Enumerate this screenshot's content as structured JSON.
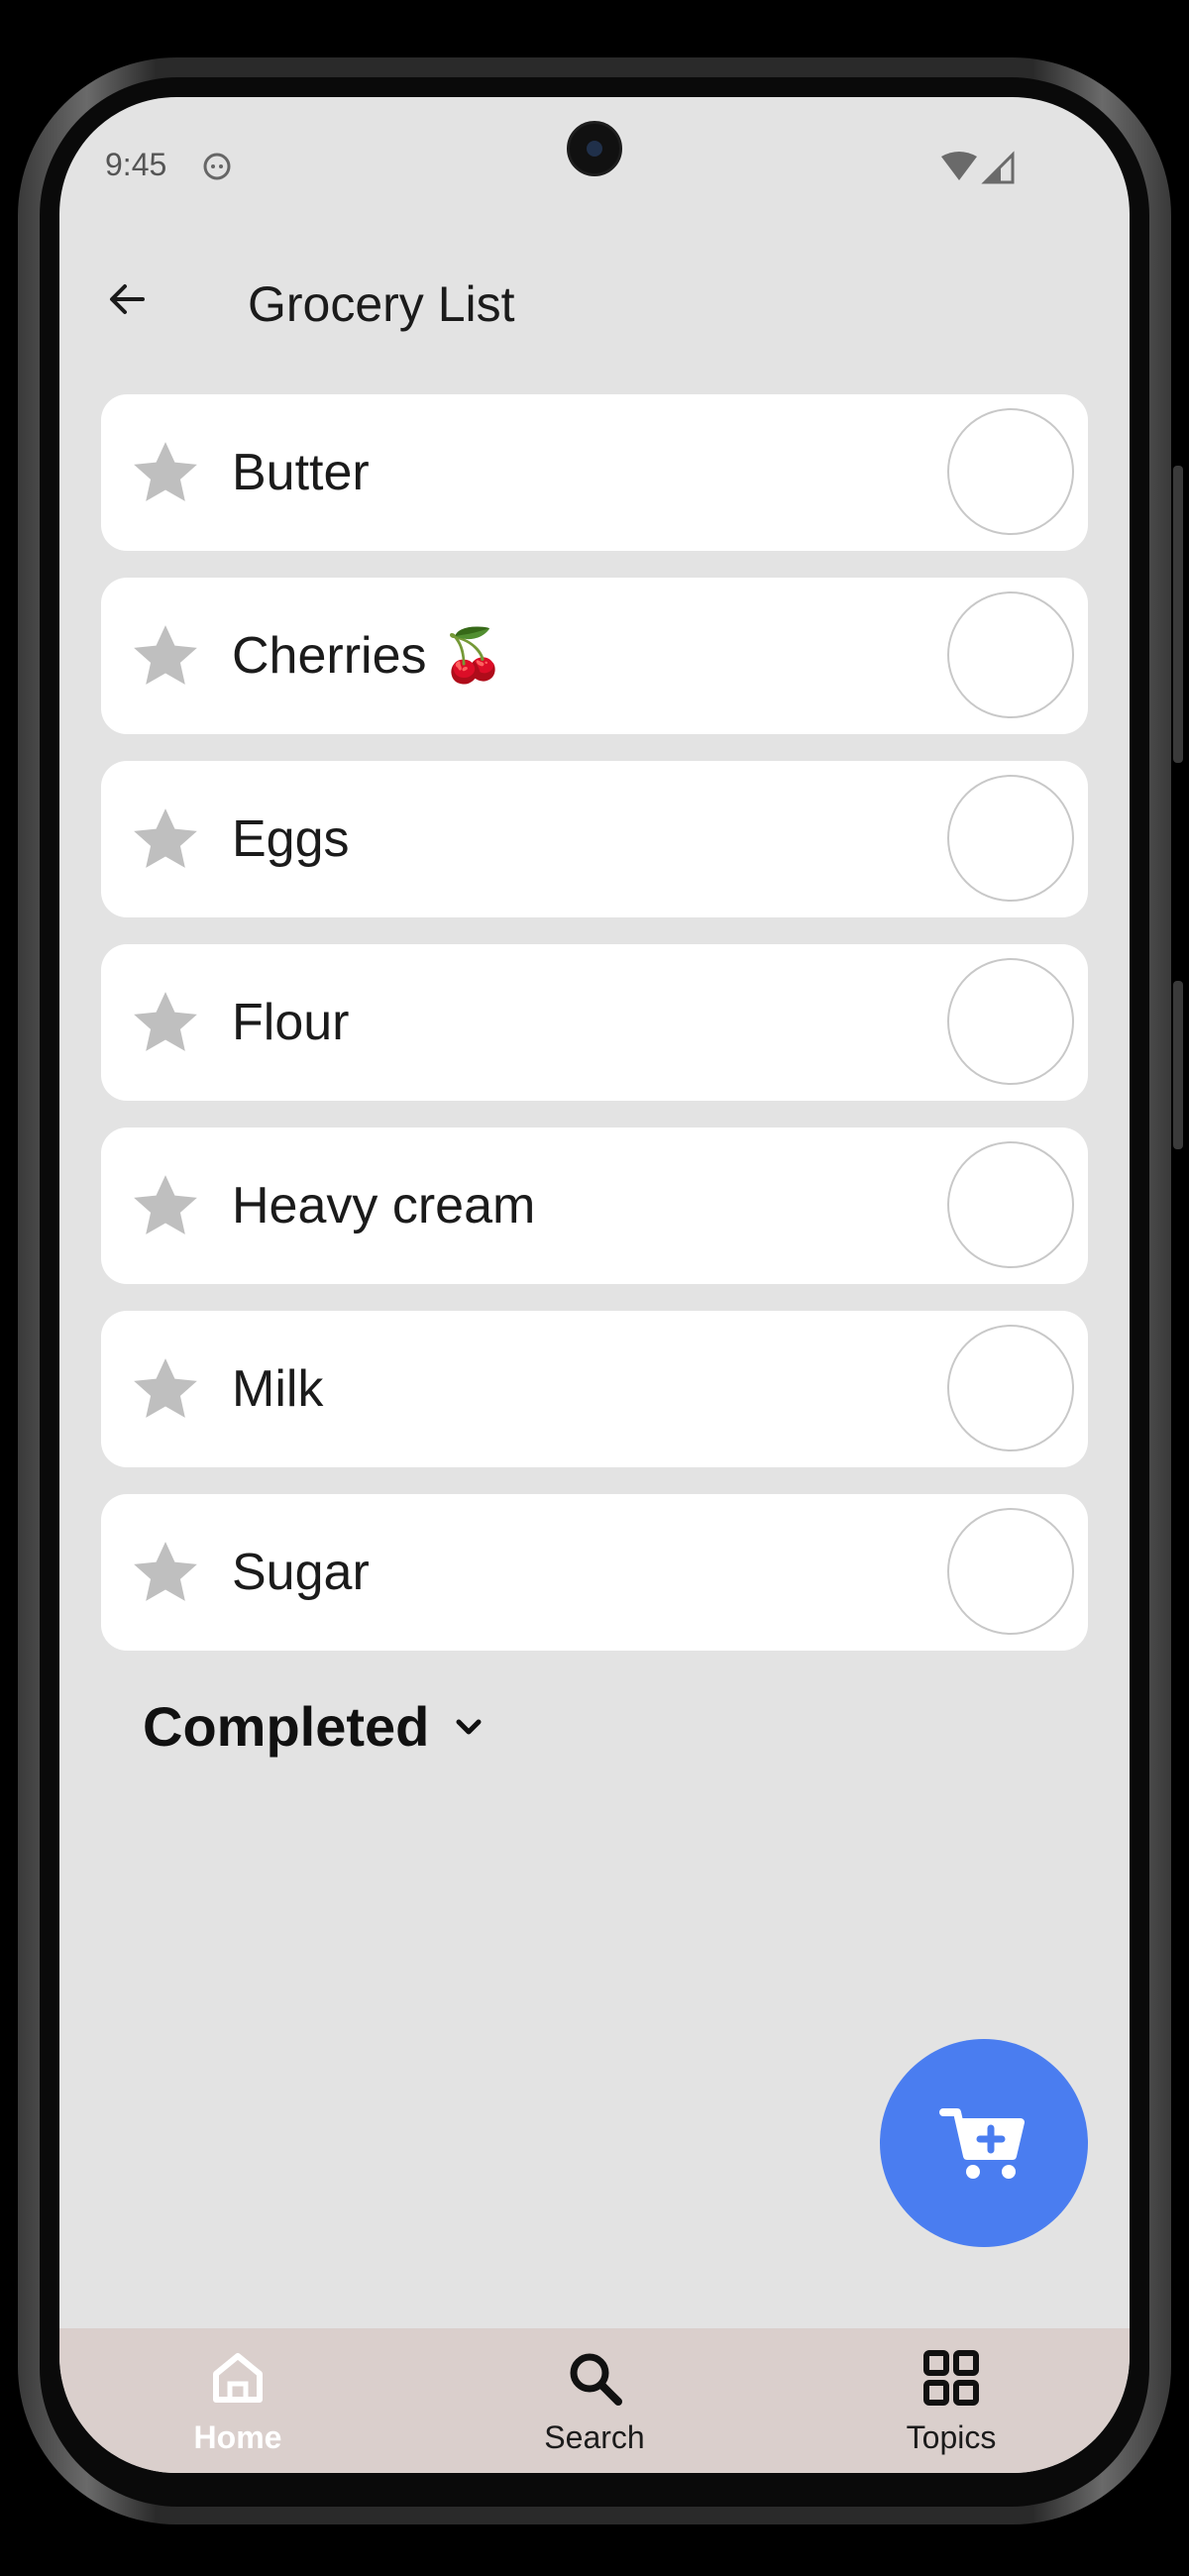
{
  "status_bar": {
    "time": "9:45"
  },
  "header": {
    "title": "Grocery List"
  },
  "items": [
    {
      "label": "Butter"
    },
    {
      "label": "Cherries 🍒"
    },
    {
      "label": "Eggs"
    },
    {
      "label": "Flour"
    },
    {
      "label": "Heavy cream"
    },
    {
      "label": "Milk"
    },
    {
      "label": "Sugar"
    }
  ],
  "completed_section": {
    "label": "Completed"
  },
  "bottom_nav": {
    "items": [
      {
        "label": "Home",
        "icon": "home-icon",
        "active": true
      },
      {
        "label": "Search",
        "icon": "search-icon",
        "active": false
      },
      {
        "label": "Topics",
        "icon": "grid-icon",
        "active": false
      }
    ]
  },
  "colors": {
    "accent": "#4a7df0",
    "screen_bg": "#e3e3e3",
    "nav_bg": "#dacfcc",
    "star": "#bfbfbf"
  }
}
